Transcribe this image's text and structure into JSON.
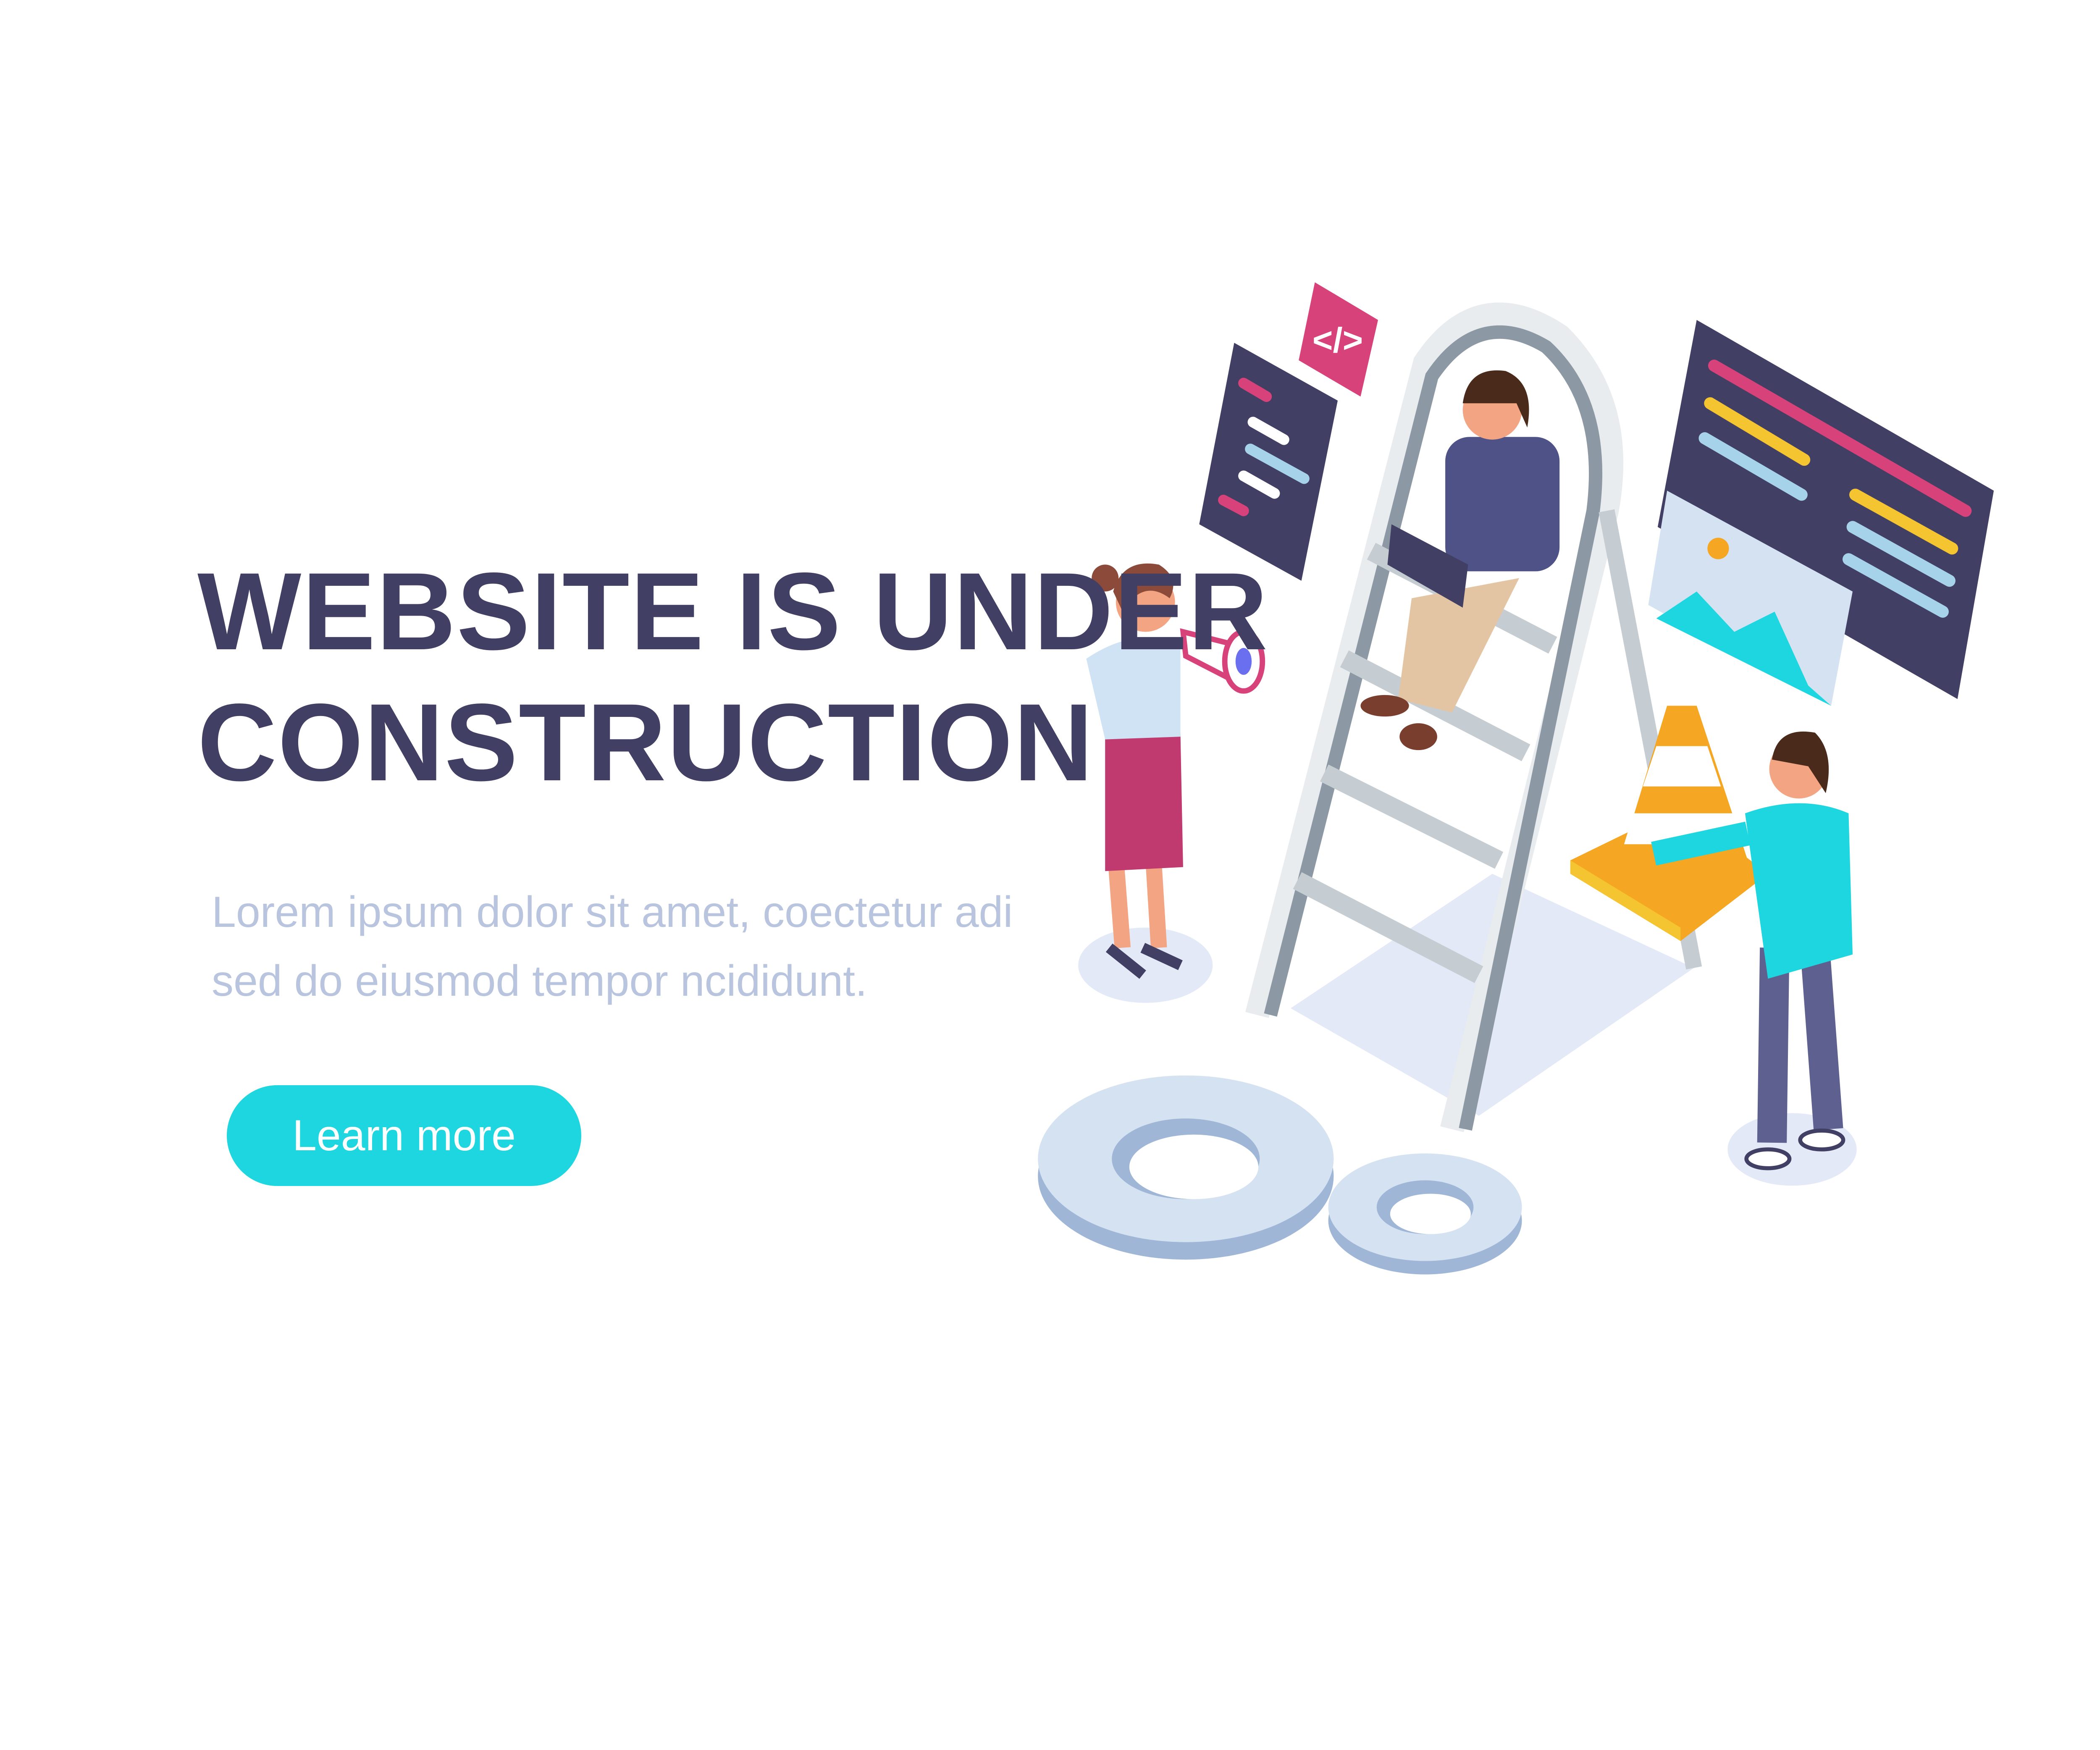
{
  "hero": {
    "title_line1": "WEBSITE IS UNDER",
    "title_line2": "CONSTRUCTION",
    "description_line1": "Lorem ipsum dolor sit amet, coectetur adi",
    "description_line2": "sed do eiusmod tempor  ncididunt.",
    "button_label": "Learn more"
  },
  "illustration": {
    "code_badge": "</>",
    "icons": [
      "code-icon",
      "image-icon",
      "megaphone-icon",
      "gear-icon",
      "traffic-cone-icon",
      "ladder-icon",
      "laptop-icon"
    ]
  },
  "colors": {
    "title": "#413f63",
    "description": "#b9c5de",
    "accent": "#1ed6df",
    "pink": "#d8427a",
    "yellow": "#f5c431"
  }
}
